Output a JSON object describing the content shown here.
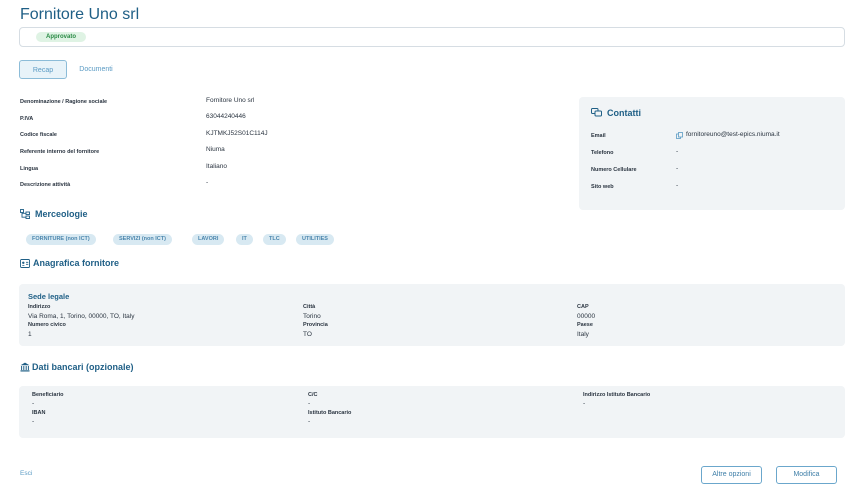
{
  "header": {
    "title": "Fornitore Uno srl",
    "status_badge": "Approvato"
  },
  "tabs": [
    {
      "label": "Recap",
      "active": true
    },
    {
      "label": "Documenti",
      "active": false
    }
  ],
  "details": [
    {
      "label": "Denominazione / Ragione sociale",
      "value": "Fornitore Uno srl"
    },
    {
      "label": "P.IVA",
      "value": "63044240446"
    },
    {
      "label": "Codice fiscale",
      "value": "KJTMKJ52S01C114J"
    },
    {
      "label": "Referente interno del fornitore",
      "value": "Niuma"
    },
    {
      "label": "Lingua",
      "value": "Italiano"
    },
    {
      "label": "Descrizione attività",
      "value": "-"
    }
  ],
  "contacts": {
    "title": "Contatti",
    "rows": [
      {
        "label": "Email",
        "value": "fornitoreuno@test-epics.niuma.it"
      },
      {
        "label": "Telefono",
        "value": "-"
      },
      {
        "label": "Numero Cellulare",
        "value": "-"
      },
      {
        "label": "Sito web",
        "value": "-"
      }
    ]
  },
  "merceologie": {
    "title": "Merceologie",
    "chips": [
      "FORNITURE (non ICT)",
      "SERVIZI (non ICT)",
      "LAVORI",
      "IT",
      "TLC",
      "UTILITIES"
    ]
  },
  "anagrafica": {
    "title": "Anagrafica fornitore",
    "sede_title": "Sede legale",
    "fields": [
      {
        "label": "Indirizzo",
        "value": "Via Roma, 1, Torino, 00000, TO, Italy"
      },
      {
        "label": "Città",
        "value": "Torino"
      },
      {
        "label": "CAP",
        "value": "00000"
      },
      {
        "label": "Numero civico",
        "value": "1"
      },
      {
        "label": "Provincia",
        "value": "TO"
      },
      {
        "label": "Paese",
        "value": "Italy"
      }
    ]
  },
  "bancari": {
    "title": "Dati bancari (opzionale)",
    "fields": [
      {
        "label": "Beneficiario",
        "value": "-"
      },
      {
        "label": "C/C",
        "value": "-"
      },
      {
        "label": "Indirizzo Istituto Bancario",
        "value": "-"
      },
      {
        "label": "IBAN",
        "value": "-"
      },
      {
        "label": "Istituto Bancario",
        "value": "-"
      }
    ]
  },
  "footer": {
    "exit_label": "Esci",
    "more_options_label": "Altre opzioni",
    "edit_label": "Modifica"
  },
  "colors": {
    "accent": "#1f5f86",
    "badge_bg": "#dff3e4",
    "badge_text": "#2a8a45",
    "panel_bg": "#f1f4f6"
  },
  "icons": {
    "contacts": "chat-bubbles-icon",
    "merceologie": "hierarchy-icon",
    "anagrafica": "id-card-icon",
    "bancari": "bank-icon",
    "email": "copy-icon"
  }
}
